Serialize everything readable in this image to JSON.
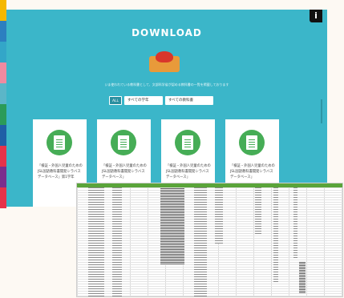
{
  "panel": {
    "title": "DOWNLOAD",
    "subtitle": "いま使われている教科書として、文部科学省が認める教科書の一覧を掲載しております",
    "info_icon": "info-icon",
    "button_icon": "red-button-icon"
  },
  "filters": {
    "all": "ALL",
    "school": "すべての学年",
    "subject": "すべての教科書"
  },
  "cards": [
    {
      "text": "「検証・外国人児童のためのJSL国語教科書開発シラバスデータベース」第1学年",
      "icon": "spreadsheet-icon"
    },
    {
      "text": "「検証・外国人児童のためのJSL国語教科書開発シラバスデータベース」",
      "icon": "spreadsheet-icon"
    },
    {
      "text": "「検証・外国人児童のためのJSL国語教科書開発シラバスデータベース」",
      "icon": "spreadsheet-icon"
    },
    {
      "text": "「検証・外国人児童のためのJSL国語教科書開発シラバスデータベース」",
      "icon": "spreadsheet-icon"
    }
  ],
  "colors": {
    "panel_bg": "#3bb6c9",
    "card_icon": "#46ad56",
    "sheet_header": "#5aa43a",
    "left_strip": [
      "#f5b800",
      "#2c7fc0",
      "#33a6c8",
      "#f08aa0",
      "#5bb6c8",
      "#2b9b58",
      "#1f5fa6",
      "#e6334a",
      "#7b2f8d",
      "#e6334a"
    ]
  }
}
